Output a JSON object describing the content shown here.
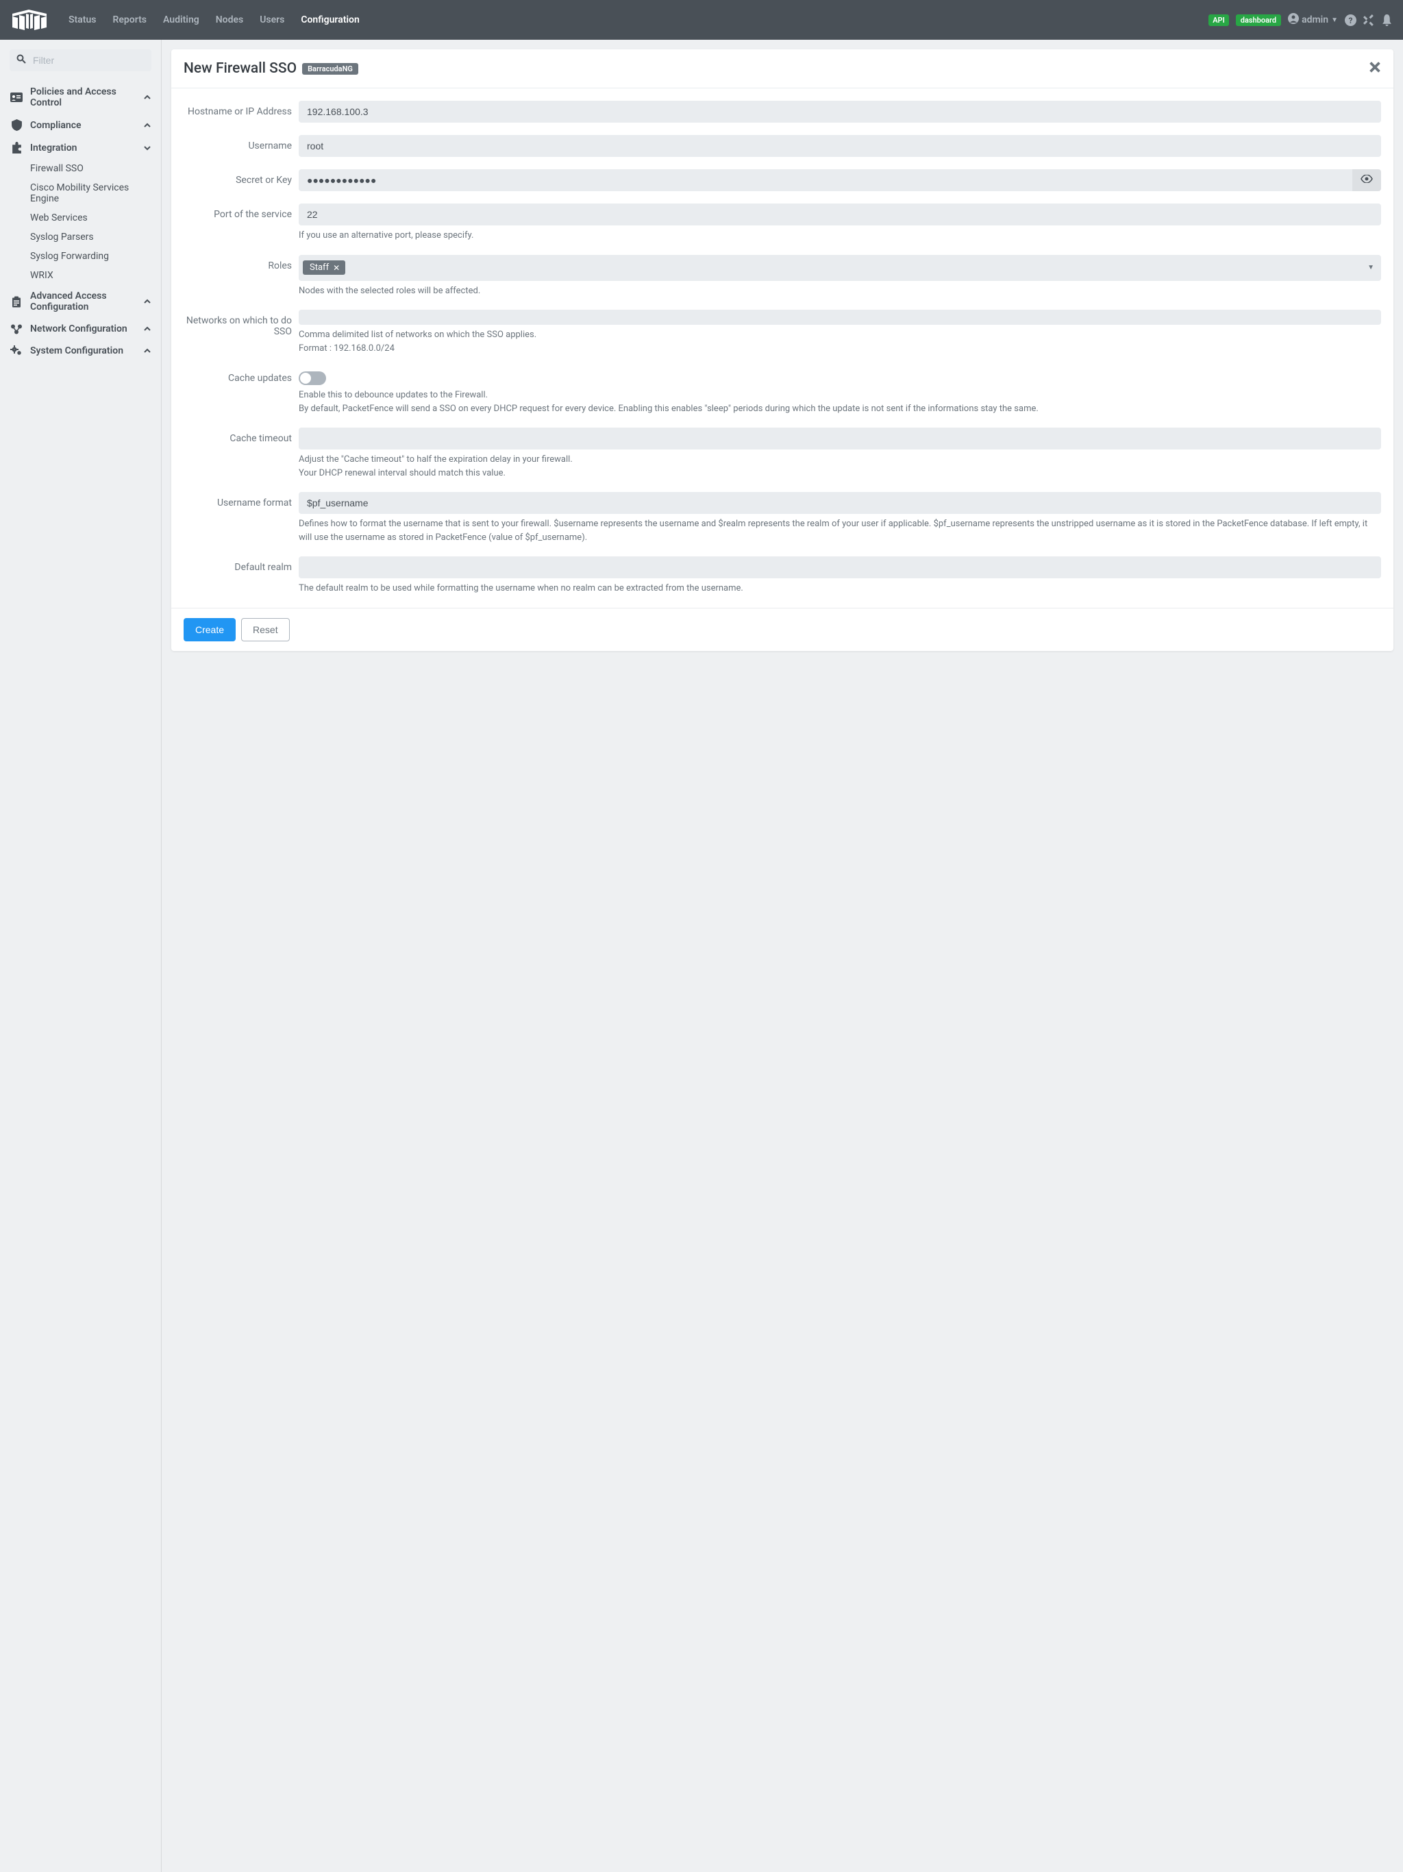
{
  "nav": {
    "links": [
      "Status",
      "Reports",
      "Auditing",
      "Nodes",
      "Users",
      "Configuration"
    ],
    "active": "Configuration",
    "api_badge": "API",
    "dashboard_badge": "dashboard",
    "user": "admin"
  },
  "sidebar": {
    "filter_placeholder": "Filter",
    "sections": [
      {
        "label": "Policies and Access Control",
        "icon": "id-card",
        "open": false
      },
      {
        "label": "Compliance",
        "icon": "shield",
        "open": false
      },
      {
        "label": "Integration",
        "icon": "puzzle",
        "open": true,
        "items": [
          "Firewall SSO",
          "Cisco Mobility Services Engine",
          "Web Services",
          "Syslog Parsers",
          "Syslog Forwarding",
          "WRIX"
        ]
      },
      {
        "label": "Advanced Access Configuration",
        "icon": "clipboard",
        "open": false
      },
      {
        "label": "Network Configuration",
        "icon": "network",
        "open": false
      },
      {
        "label": "System Configuration",
        "icon": "gears",
        "open": false
      }
    ]
  },
  "form": {
    "title": "New Firewall SSO",
    "type_badge": "BarracudaNG",
    "hostname": {
      "label": "Hostname or IP Address",
      "value": "192.168.100.3"
    },
    "username": {
      "label": "Username",
      "value": "root"
    },
    "secret": {
      "label": "Secret or Key",
      "value": "●●●●●●●●●●●●"
    },
    "port": {
      "label": "Port of the service",
      "value": "22",
      "help": "If you use an alternative port, please specify."
    },
    "roles": {
      "label": "Roles",
      "chips": [
        "Staff"
      ],
      "help": "Nodes with the selected roles will be affected."
    },
    "networks": {
      "label": "Networks on which to do SSO",
      "value": "",
      "help1": "Comma delimited list of networks on which the SSO applies.",
      "help2": "Format : 192.168.0.0/24"
    },
    "cache_updates": {
      "label": "Cache updates",
      "on": false,
      "help1": "Enable this to debounce updates to the Firewall.",
      "help2": "By default, PacketFence will send a SSO on every DHCP request for every device. Enabling this enables \"sleep\" periods during which the update is not sent if the informations stay the same."
    },
    "cache_timeout": {
      "label": "Cache timeout",
      "value": "",
      "help1": "Adjust the \"Cache timeout\" to half the expiration delay in your firewall.",
      "help2": "Your DHCP renewal interval should match this value."
    },
    "username_format": {
      "label": "Username format",
      "value": "$pf_username",
      "help": "Defines how to format the username that is sent to your firewall. $username represents the username and $realm represents the realm of your user if applicable. $pf_username represents the unstripped username as it is stored in the PacketFence database. If left empty, it will use the username as stored in PacketFence (value of $pf_username)."
    },
    "default_realm": {
      "label": "Default realm",
      "value": "",
      "help": "The default realm to be used while formatting the username when no realm can be extracted from the username."
    },
    "create_btn": "Create",
    "reset_btn": "Reset"
  }
}
